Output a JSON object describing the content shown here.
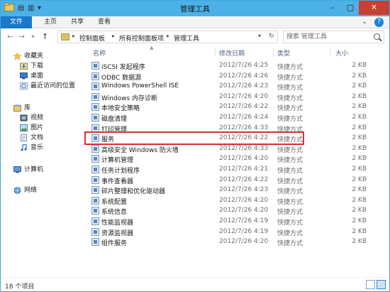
{
  "window": {
    "title": "管理工具",
    "controls": {
      "minimize": "–",
      "maximize": "□",
      "close": "✕"
    }
  },
  "quick_access": {
    "icon_a": "▤",
    "icon_b": "▥",
    "icon_c": "▾",
    "sep": "|"
  },
  "ribbon": {
    "tabs": [
      "文件",
      "主页",
      "共享",
      "查看"
    ],
    "expand": "⌄",
    "help": "?"
  },
  "address": {
    "back": "←",
    "forward": "→",
    "recent": "▾",
    "up": "↑",
    "crumbs": [
      "控制面板",
      "所有控制面板项",
      "管理工具"
    ],
    "separator": "▸",
    "dropdown": "▾",
    "refresh": "↻"
  },
  "search": {
    "placeholder": "搜索 管理工具"
  },
  "nav": {
    "favorites": "收藏夹",
    "downloads": "下载",
    "desktop": "桌面",
    "recent": "最近访问的位置",
    "libraries": "库",
    "videos": "视频",
    "pictures": "图片",
    "documents": "文档",
    "music": "音乐",
    "computer": "计算机",
    "network": "网络"
  },
  "columns": {
    "name": "名称",
    "date": "修改日期",
    "type": "类型",
    "size": "大小",
    "sort_indicator": "▲"
  },
  "files": [
    {
      "name": "iSCSI 发起程序",
      "date": "2012/7/26 4:25",
      "type": "快捷方式",
      "size": "2 KB"
    },
    {
      "name": "ODBC 数据源",
      "date": "2012/7/26 4:26",
      "type": "快捷方式",
      "size": "2 KB"
    },
    {
      "name": "Windows PowerShell ISE",
      "date": "2012/7/26 4:23",
      "type": "快捷方式",
      "size": "2 KB"
    },
    {
      "name": "Windows 内存诊断",
      "date": "2012/7/26 4:20",
      "type": "快捷方式",
      "size": "2 KB"
    },
    {
      "name": "本地安全策略",
      "date": "2012/7/26 4:22",
      "type": "快捷方式",
      "size": "2 KB"
    },
    {
      "name": "磁盘清理",
      "date": "2012/7/26 4:24",
      "type": "快捷方式",
      "size": "2 KB"
    },
    {
      "name": "打印管理",
      "date": "2012/7/26 4:33",
      "type": "快捷方式",
      "size": "2 KB"
    },
    {
      "name": "服务",
      "date": "2012/7/26 4:22",
      "type": "快捷方式",
      "size": "2 KB"
    },
    {
      "name": "高级安全 Windows 防火墙",
      "date": "2012/7/26 4:33",
      "type": "快捷方式",
      "size": "2 KB"
    },
    {
      "name": "计算机管理",
      "date": "2012/7/26 4:20",
      "type": "快捷方式",
      "size": "2 KB"
    },
    {
      "name": "任务计划程序",
      "date": "2012/7/26 4:21",
      "type": "快捷方式",
      "size": "2 KB"
    },
    {
      "name": "事件查看器",
      "date": "2012/7/26 4:22",
      "type": "快捷方式",
      "size": "2 KB"
    },
    {
      "name": "碎片整理和优化驱动器",
      "date": "2012/7/26 4:23",
      "type": "快捷方式",
      "size": "2 KB"
    },
    {
      "name": "系统配置",
      "date": "2012/7/26 4:20",
      "type": "快捷方式",
      "size": "2 KB"
    },
    {
      "name": "系统信息",
      "date": "2012/7/26 4:20",
      "type": "快捷方式",
      "size": "2 KB"
    },
    {
      "name": "性能监视器",
      "date": "2012/7/26 4:19",
      "type": "快捷方式",
      "size": "2 KB"
    },
    {
      "name": "资源监视器",
      "date": "2012/7/26 4:19",
      "type": "快捷方式",
      "size": "2 KB"
    },
    {
      "name": "组件服务",
      "date": "2012/7/26 4:20",
      "type": "快捷方式",
      "size": "2 KB"
    }
  ],
  "highlighted_file": "服务",
  "status": {
    "count": "18 个项目"
  },
  "colors": {
    "titlebar": "#4cb1e6",
    "file_tab": "#1979ca",
    "highlight": "#d9302f",
    "close": "#c84031"
  }
}
